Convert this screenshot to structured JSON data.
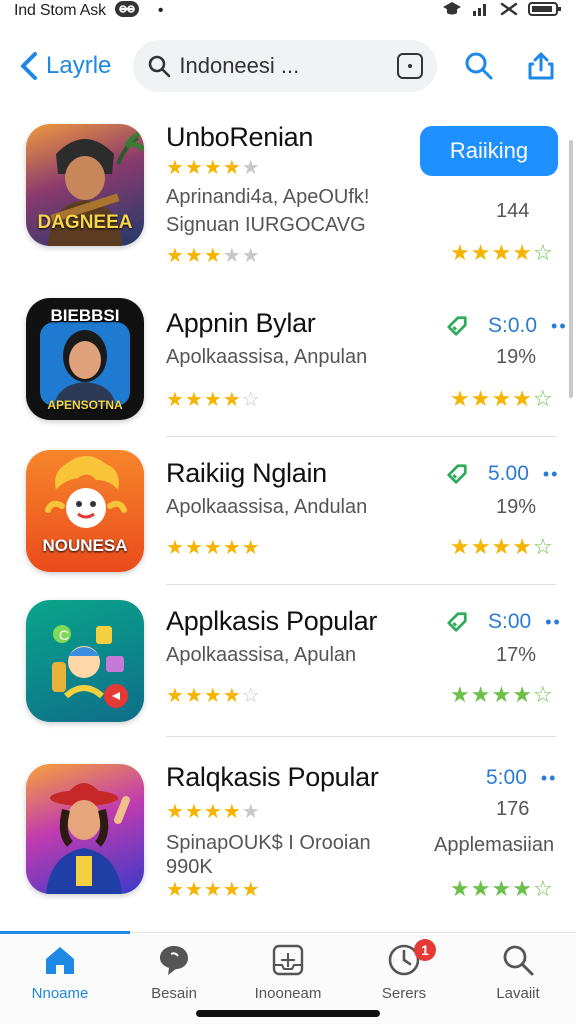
{
  "status_bar": {
    "carrier": "Ind Stom Ask",
    "icons": [
      "link-badge-icon",
      "dot-icon",
      "cap-icon",
      "signal-icon",
      "wifi-icon",
      "battery-icon"
    ]
  },
  "nav": {
    "back_label": "Layrle",
    "search_placeholder": "Indoneesi ...",
    "accent": "#1e88e5"
  },
  "apps": [
    {
      "title": "UnboRenian",
      "icon_caption": "DAGNEEA",
      "rating_stars": 4,
      "subtitle_line1": "Aprinandi4a, ApeOUfk!",
      "subtitle_line2": "Signuan IURGOCAVG",
      "meta": "144",
      "bottom_stars_user": 3.5,
      "bottom_stars_right": 4,
      "action_label": "Raiiking",
      "price": ""
    },
    {
      "title": "Appnin Bylar",
      "icon_caption_top": "BIEBBSI",
      "icon_caption": "APENSOTNA",
      "subtitle_line1": "Apolkaassisa, Anpulan",
      "meta": "19%",
      "bottom_stars_user": 4,
      "bottom_stars_right": 4,
      "price": "S:0.0"
    },
    {
      "title": "Raikiig Nglain",
      "icon_caption": "NOUNESA",
      "subtitle_line1": "Apolkaassisa, Andulan",
      "meta": "19%",
      "bottom_stars_user": 5,
      "bottom_stars_right": 4,
      "price": "5.00"
    },
    {
      "title": "Applkasis Popular",
      "icon_caption": "",
      "subtitle_line1": "Apolkaassisa, Apulan",
      "meta": "17%",
      "bottom_stars_user": 4,
      "bottom_stars_right": 4,
      "price": "S:00"
    },
    {
      "title": "Ralqkasis Popular",
      "icon_caption": "",
      "rating_stars": 4,
      "subtitle_line1": "SpinapOUK$ I Orooian",
      "subtitle_line2": "990K",
      "meta": "176",
      "meta2": "Applemasiian",
      "bottom_stars_user": 5,
      "bottom_stars_right": 4,
      "price": "5:00"
    }
  ],
  "tabs": [
    {
      "label": "Nnoame",
      "icon": "home-icon",
      "active": true
    },
    {
      "label": "Besain",
      "icon": "chat-bubble-icon",
      "active": false
    },
    {
      "label": "Inooneam",
      "icon": "inbox-icon",
      "active": false
    },
    {
      "label": "Serers",
      "icon": "clock-icon",
      "active": false,
      "badge": "1"
    },
    {
      "label": "Lavaiit",
      "icon": "search-icon",
      "active": false
    }
  ]
}
